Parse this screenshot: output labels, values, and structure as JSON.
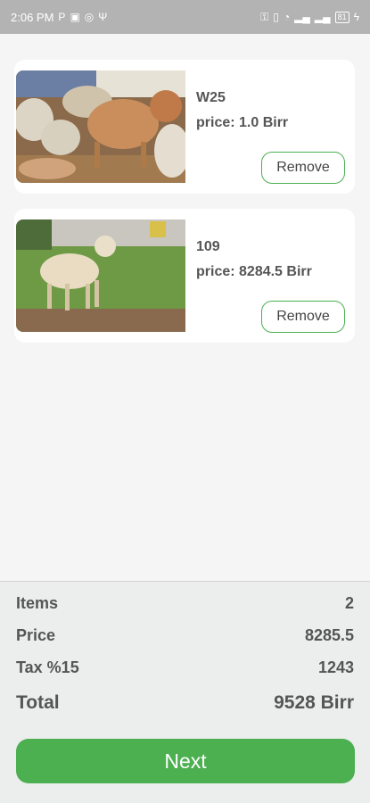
{
  "status_bar": {
    "time": "2:06 PM",
    "left_icons": [
      "parking-icon",
      "image-icon",
      "vpn-icon",
      "usb-icon"
    ],
    "right_icons": [
      "key-icon",
      "vibrate-icon",
      "wifi-icon",
      "signal-icon",
      "signal-icon",
      "battery-icon",
      "charging-icon"
    ],
    "battery": "81"
  },
  "cart": {
    "items": [
      {
        "name": "W25",
        "price": "price: 1.0 Birr",
        "remove_label": "Remove",
        "image": "goats-herd-photo"
      },
      {
        "name": "109",
        "price": "price: 8284.5 Birr",
        "remove_label": "Remove",
        "image": "sheep-field-photo"
      }
    ]
  },
  "summary": {
    "items_label": "Items",
    "items_value": "2",
    "price_label": "Price",
    "price_value": "8285.5",
    "tax_label": "Tax %15",
    "tax_value": "1243",
    "total_label": "Total",
    "total_value": "9528 Birr"
  },
  "next_label": "Next",
  "colors": {
    "accent": "#4caf50",
    "status_bar": "#b3b3b3",
    "background": "#f5f5f5"
  }
}
